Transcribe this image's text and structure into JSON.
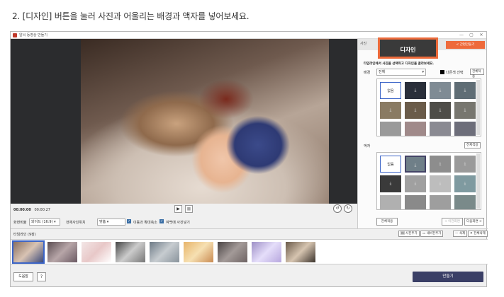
{
  "caption": "2. [디자인] 버튼을 눌러 사진과 어울리는 배경과 액자를 넣어보세요.",
  "window": {
    "title": "알씨 동영상 만들기",
    "controls": [
      "—",
      "▢",
      "✕"
    ]
  },
  "player": {
    "time_current": "00:00:00",
    "time_total": "00:00:27",
    "play_icon": "▶",
    "stop_icon": "■"
  },
  "options": {
    "ratio_label": "화면비율",
    "ratio_value": "와이드 (16:9)",
    "position_label": "전체사진위치",
    "position_value": "맞춤",
    "move_label": "이동과 확대축소",
    "fill_label": "여백에 사진넣기"
  },
  "timeline": {
    "label": "타임라인 (9장)",
    "add_photo": "사진추가",
    "add_video": "새비전추가",
    "delete": "삭제",
    "delete_all": "전체삭제"
  },
  "bottom": {
    "help": "도움말",
    "question": "?",
    "make": "만들기"
  },
  "panel": {
    "tab_left": "사진",
    "tab_design": "디자인",
    "simple_make": "간편만들기",
    "hint": "타임라인에서 사진을 선택하고 디자인을 골라보세요.",
    "bg_label": "배경",
    "bg_select": "전체",
    "color_select": "다른색 선택",
    "apply_all_bg": "전체적용",
    "frame_label": "액자",
    "apply_all_frame": "전체적용",
    "none_label": "없음",
    "apply_all": "전체적용",
    "prev": "< 이전화면",
    "next": "다음화면 >"
  },
  "colors": {
    "accent_orange": "#ee6a3b",
    "selection_blue": "#3b64c7",
    "make_button": "#3a3f66"
  }
}
